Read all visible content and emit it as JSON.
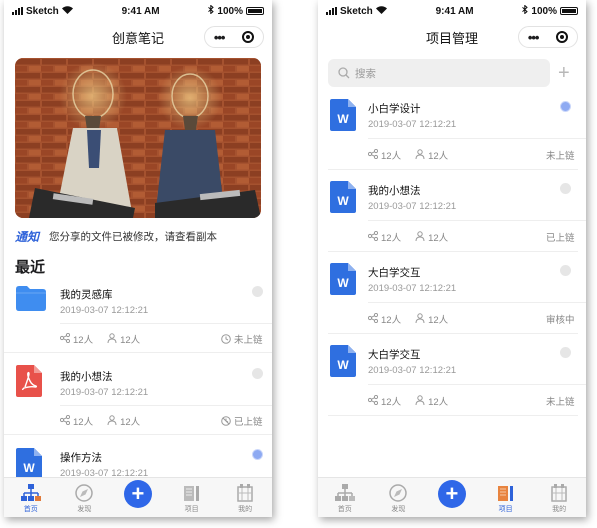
{
  "status_bar": {
    "carrier": "Sketch",
    "time": "9:41 AM",
    "battery": "100%"
  },
  "left": {
    "title": "创意笔记",
    "notice_tag": "通知",
    "notice_text": "您分享的文件已被修改，请查看副本",
    "section_title": "最近",
    "items": [
      {
        "name": "我的灵感库",
        "date": "2019-03-07  12:12:21",
        "share": "12人",
        "people": "12人",
        "status": "未上链",
        "icon": "folder-icon",
        "selected": false
      },
      {
        "name": "我的小想法",
        "date": "2019-03-07  12:12:21",
        "share": "12人",
        "people": "12人",
        "status": "已上链",
        "icon": "pdf-icon",
        "selected": false
      },
      {
        "name": "操作方法",
        "date": "2019-03-07  12:12:21",
        "share": "",
        "people": "",
        "status": "",
        "icon": "word-doc-icon",
        "selected": true
      }
    ]
  },
  "right": {
    "title": "项目管理",
    "search_placeholder": "搜索",
    "items": [
      {
        "name": "小白学设计",
        "date": "2019-03-07  12:12:21",
        "share": "12人",
        "people": "12人",
        "status": "未上链",
        "selected": true
      },
      {
        "name": "我的小想法",
        "date": "2019-03-07  12:12:21",
        "share": "12人",
        "people": "12人",
        "status": "已上链",
        "selected": false
      },
      {
        "name": "大白学交互",
        "date": "2019-03-07  12:12:21",
        "share": "12人",
        "people": "12人",
        "status": "审核中",
        "selected": false
      },
      {
        "name": "大白学交互",
        "date": "2019-03-07  12:12:21",
        "share": "12人",
        "people": "12人",
        "status": "未上链",
        "selected": false
      }
    ]
  },
  "tabs": {
    "home": "首页",
    "discover": "发现",
    "project": "项目",
    "mine": "我的"
  },
  "colors": {
    "accent": "#2f67e8",
    "word_blue": "#2f6fe0",
    "pdf_red": "#e8514a",
    "folder_blue": "#3f8df0"
  }
}
